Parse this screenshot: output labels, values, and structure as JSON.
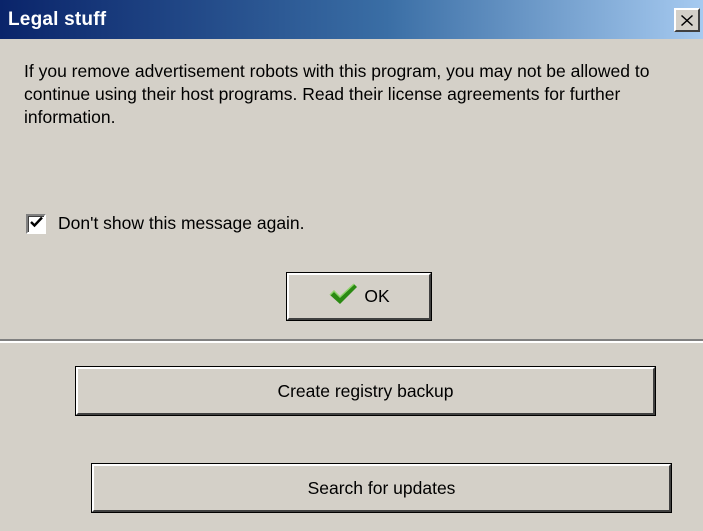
{
  "dialog": {
    "title": "Legal stuff",
    "message": "If you remove advertisement robots with this program, you may not be allowed to continue using their host programs. Read their license agreements for further information.",
    "checkbox": {
      "label": "Don't show this message again.",
      "checked": true
    },
    "ok_button": {
      "label": "OK",
      "icon": "checkmark-icon"
    },
    "close_icon": "close-icon"
  },
  "main": {
    "backup_button": "Create registry backup",
    "updates_button": "Search for updates"
  },
  "colors": {
    "face": "#d4d0c8",
    "title_start": "#0a246a",
    "title_end": "#a6caf0",
    "check_green": "#2a8a12"
  }
}
